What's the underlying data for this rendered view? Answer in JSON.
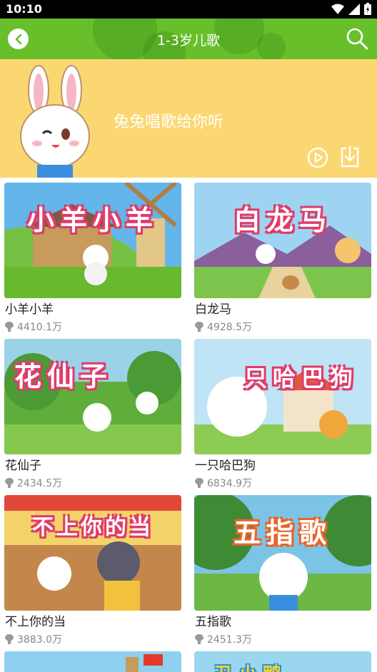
{
  "status": {
    "time": "10:10"
  },
  "header": {
    "title": "1-3岁儿歌"
  },
  "hero": {
    "text": "兔兔唱歌给你听"
  },
  "songs": [
    {
      "title": "小羊小羊",
      "plays": "4410.1万",
      "thumb_title": "小羊小羊"
    },
    {
      "title": "白龙马",
      "plays": "4928.5万",
      "thumb_title": "白龙马"
    },
    {
      "title": "花仙子",
      "plays": "2434.5万",
      "thumb_title": "花仙子"
    },
    {
      "title": "一只哈巴狗",
      "plays": "6834.9万",
      "thumb_title": "只哈巴狗"
    },
    {
      "title": "不上你的当",
      "plays": "3883.0万",
      "thumb_title": "不上你的当"
    },
    {
      "title": "五指歌",
      "plays": "2451.3万",
      "thumb_title": "五指歌"
    },
    {
      "title": "",
      "plays": "",
      "thumb_title": ""
    },
    {
      "title": "",
      "plays": "",
      "thumb_title": "丑小鸭"
    }
  ],
  "colors": {
    "app_bar": "#67bf2a",
    "hero": "#fbd772",
    "title_text": "#222222",
    "meta_text": "#888888"
  },
  "icons": {
    "back": "chevron-left-icon",
    "search": "search-icon",
    "play": "play-icon",
    "download": "download-icon",
    "plays": "play-count-icon"
  }
}
